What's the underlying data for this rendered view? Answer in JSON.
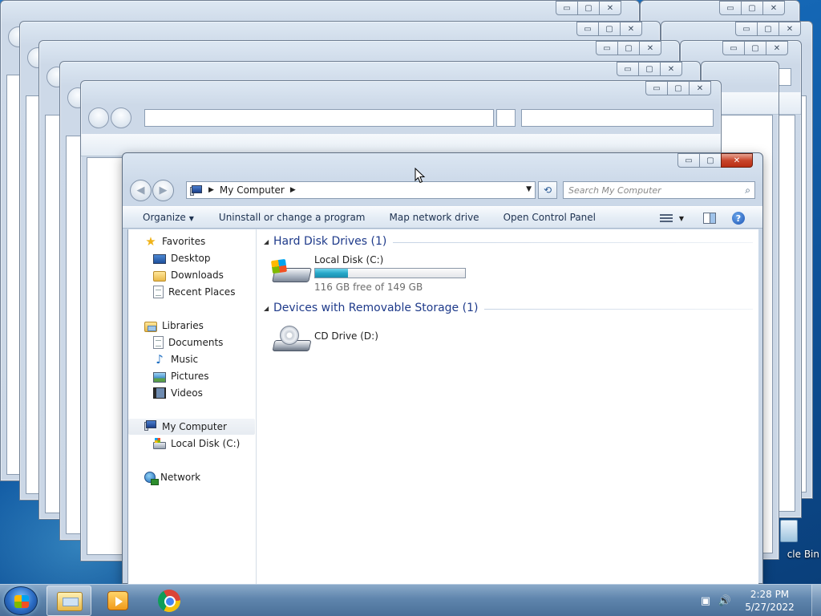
{
  "window": {
    "caption_buttons": {
      "minimize": "▭",
      "maximize": "▢",
      "close": "✕"
    }
  },
  "address": {
    "location": "My Computer"
  },
  "search": {
    "placeholder": "Search My Computer"
  },
  "commands": {
    "organize": "Organize",
    "uninstall": "Uninstall or change a program",
    "map_drive": "Map network drive",
    "control_panel": "Open Control Panel",
    "help": "?"
  },
  "nav": {
    "favorites": "Favorites",
    "desktop": "Desktop",
    "downloads": "Downloads",
    "recent_places": "Recent Places",
    "libraries": "Libraries",
    "documents": "Documents",
    "music": "Music",
    "pictures": "Pictures",
    "videos": "Videos",
    "my_computer": "My Computer",
    "local_disk": "Local Disk (C:)",
    "network": "Network"
  },
  "content": {
    "hdd_group": "Hard Disk Drives (1)",
    "removable_group": "Devices with Removable Storage (1)",
    "drive_c": {
      "name": "Local Disk (C:)",
      "free_text": "116 GB free of 149 GB",
      "used_fraction": 0.22
    },
    "drive_d": {
      "name": "CD Drive (D:)"
    }
  },
  "desktop": {
    "recycle_bin_label": "cle Bin"
  },
  "taskbar": {
    "time": "2:28 PM",
    "date": "5/27/2022"
  },
  "icons": {
    "back": "back-arrow-icon",
    "forward": "forward-arrow-icon",
    "refresh": "refresh-icon",
    "search": "magnifier-icon",
    "view": "change-view-icon",
    "preview_pane": "preview-pane-icon",
    "help": "help-icon"
  },
  "colors": {
    "group_header": "#1e3a8a",
    "disk_bar": "#27a8c9",
    "close_button": "#c8462c"
  }
}
